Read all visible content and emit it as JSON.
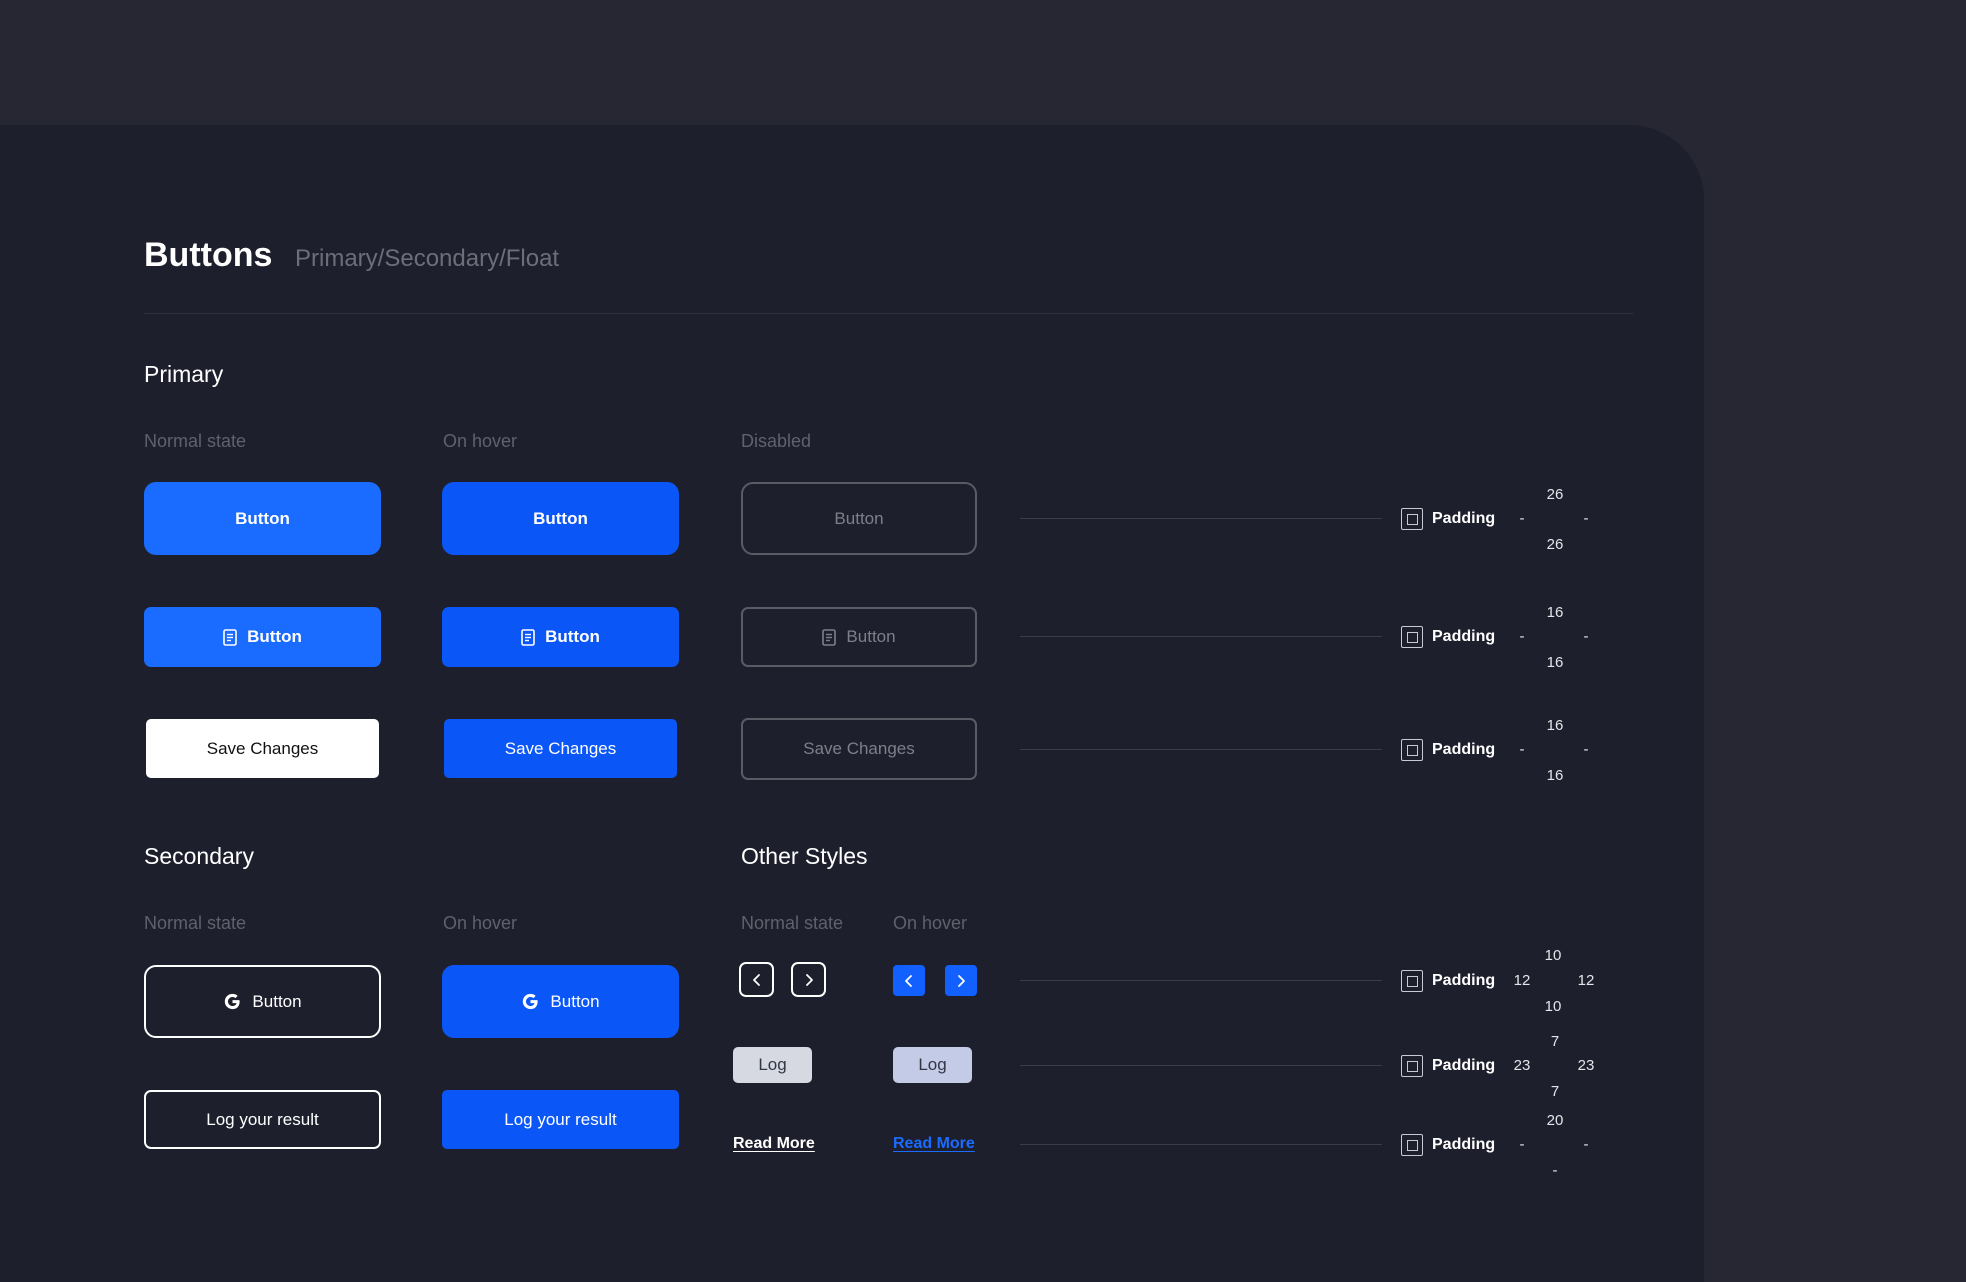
{
  "header": {
    "title": "Buttons",
    "subtitle": "Primary/Secondary/Float"
  },
  "primary": {
    "title": "Primary",
    "col_normal": "Normal state",
    "col_hover": "On hover",
    "col_disabled": "Disabled",
    "row1_label": "Button",
    "row2_label": "Button",
    "row3_label": "Save Changes"
  },
  "secondary": {
    "title": "Secondary",
    "col_normal": "Normal state",
    "col_hover": "On hover",
    "row1_label": "Button",
    "row2_label": "Log your result"
  },
  "other": {
    "title": "Other Styles",
    "col_normal": "Normal state",
    "col_hover": "On hover",
    "log_label": "Log",
    "read_more": "Read More"
  },
  "padding": {
    "label": "Padding",
    "rows": [
      {
        "top": "26",
        "left": "-",
        "right": "-",
        "bottom": "26"
      },
      {
        "top": "16",
        "left": "-",
        "right": "-",
        "bottom": "16"
      },
      {
        "top": "16",
        "left": "-",
        "right": "-",
        "bottom": "16"
      },
      {
        "top": "10",
        "left": "12",
        "right": "12",
        "bottom": "10"
      },
      {
        "top": "7",
        "left": "23",
        "right": "23",
        "bottom": "7"
      },
      {
        "top": "20",
        "left": "-",
        "right": "-",
        "bottom": "-"
      }
    ]
  },
  "colors": {
    "primary": "#1a6bff",
    "hover": "#0b56f7",
    "panel": "#1e1f2c",
    "background": "#262733",
    "link_hover": "#1a6bff"
  },
  "icons": {
    "document": "document-icon",
    "google": "google-icon",
    "chevron_left": "chevron-left-icon",
    "chevron_right": "chevron-right-icon",
    "padding": "padding-icon"
  }
}
